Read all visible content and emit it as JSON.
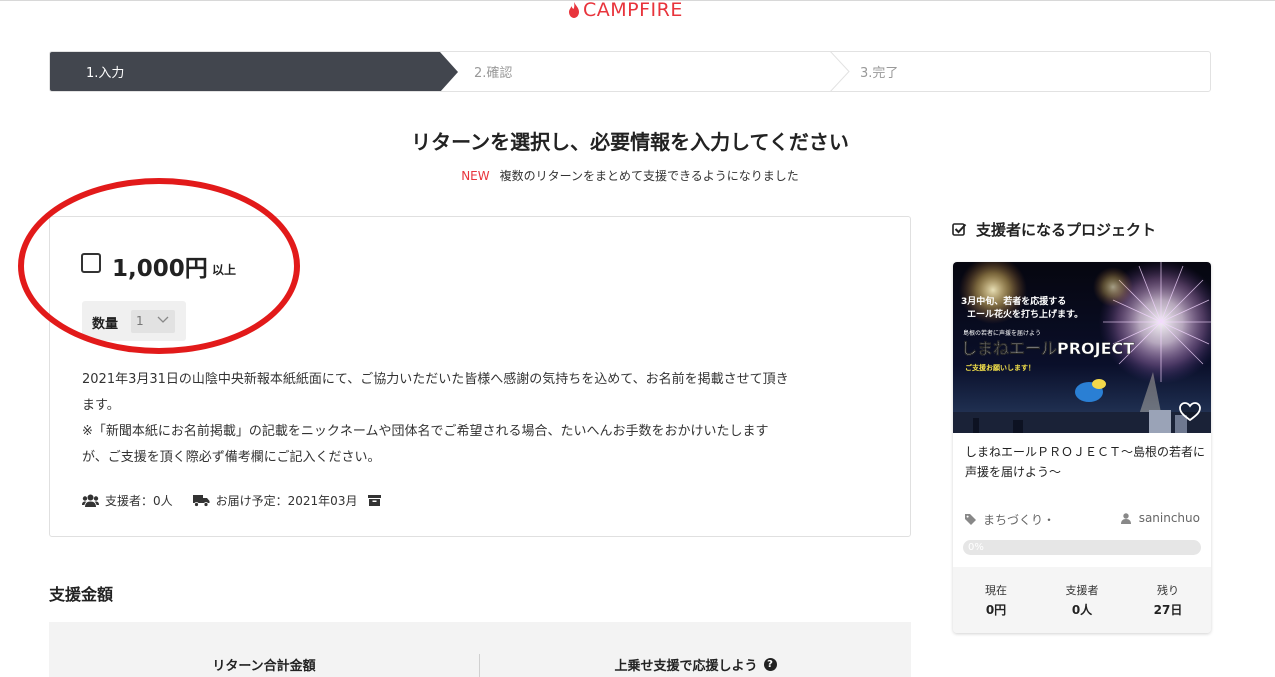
{
  "brand": {
    "logo_text": "CAMPFIRE",
    "accent": "#e8343c"
  },
  "steps": [
    {
      "label": "1.入力",
      "active": true
    },
    {
      "label": "2.確認",
      "active": false
    },
    {
      "label": "3.完了",
      "active": false
    }
  ],
  "heading": {
    "title": "リターンを選択し、必要情報を入力してください",
    "new_badge": "NEW",
    "note": "複数のリターンをまとめて支援できるようになりました"
  },
  "reward": {
    "price": "1,000円",
    "price_suffix": "以上",
    "quantity_label": "数量",
    "quantity_value": "1",
    "description_lines": [
      "2021年3月31日の山陰中央新報本紙紙面にて、ご協力いただいた皆様へ感謝の気持ちを込めて、お名前を掲載させて頂き",
      "ます。",
      "※「新聞本紙にお名前掲載」の記載をニックネームや団体名でご希望される場合、たいへんお手数をおかけいたします",
      "が、ご支援を頂く際必ず備考欄にご記入ください。"
    ],
    "supporters": "支援者：0人",
    "delivery": "お届け予定：2021年03月"
  },
  "amount": {
    "section_title": "支援金額",
    "total_label": "リターン合計金額",
    "extra_label": "上乗せ支援で応援しよう"
  },
  "sidebar": {
    "title": "支援者になるプロジェクト",
    "project": {
      "image_text_top1": "3月中旬、若者を応援する",
      "image_text_top2": "エール花火を打ち上げます。",
      "image_text_small": "島根の若者に声援を届けよう",
      "image_text_main": "しまねエールPROJECT",
      "image_text_sub": "ご支援お願いします！",
      "name": "しまねエールＰＲＯＪＥＣＴ〜島根の若者に声援を届けよう〜",
      "category": "まちづくり・",
      "owner": "saninchuo",
      "progress_text": "0%",
      "progress": 0,
      "stats": [
        {
          "label": "現在",
          "value": "0円"
        },
        {
          "label": "支援者",
          "value": "0人"
        },
        {
          "label": "残り",
          "value": "27日"
        }
      ]
    }
  }
}
